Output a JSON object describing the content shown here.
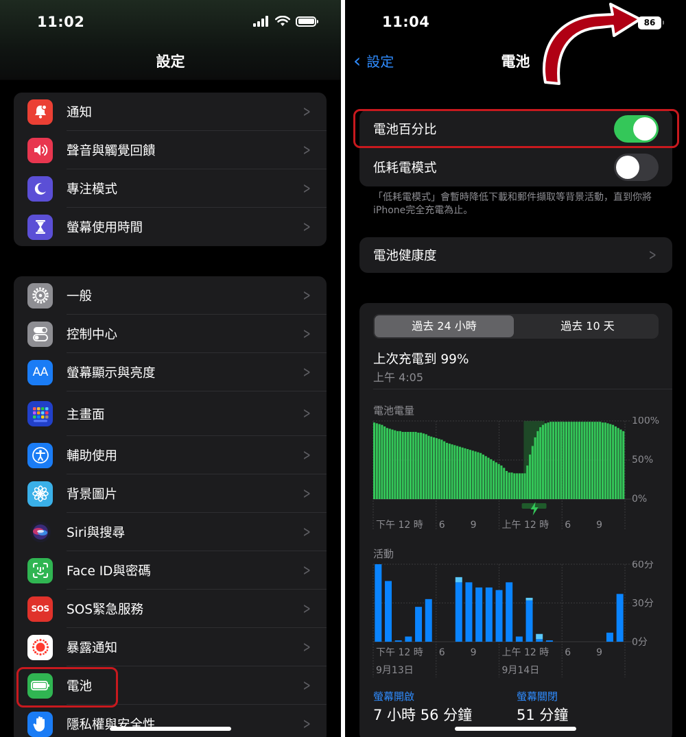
{
  "left": {
    "status_time": "11:02",
    "title": "設定",
    "group1": [
      {
        "label": "通知",
        "icon": "bell-icon",
        "color": "#eb4034"
      },
      {
        "label": "聲音與觸覺回饋",
        "icon": "speaker-icon",
        "color": "#e8364f"
      },
      {
        "label": "專注模式",
        "icon": "moon-icon",
        "color": "#5b4fd6"
      },
      {
        "label": "螢幕使用時間",
        "icon": "hourglass-icon",
        "color": "#5b4fd6"
      }
    ],
    "group2": [
      {
        "label": "一般",
        "icon": "gear-icon",
        "color": "#8e8e93"
      },
      {
        "label": "控制中心",
        "icon": "toggles-icon",
        "color": "#8e8e93"
      },
      {
        "label": "螢幕顯示與亮度",
        "icon": "text-size-icon",
        "color": "#1a7cf5"
      },
      {
        "label": "主畫面",
        "icon": "home-grid-icon",
        "color": "#2140c9"
      },
      {
        "label": "輔助使用",
        "icon": "accessibility-icon",
        "color": "#1a7cf5"
      },
      {
        "label": "背景圖片",
        "icon": "flower-icon",
        "color": "#3ab0e8"
      },
      {
        "label": "Siri與搜尋",
        "icon": "siri-icon",
        "color": "#1c1c1e"
      },
      {
        "label": "Face ID與密碼",
        "icon": "face-id-icon",
        "color": "#30b552"
      },
      {
        "label": "SOS緊急服務",
        "icon": "sos-icon",
        "color": "#e0322b"
      },
      {
        "label": "暴露通知",
        "icon": "exposure-icon",
        "color": "#ffffff"
      },
      {
        "label": "電池",
        "icon": "battery-icon",
        "color": "#30b552"
      },
      {
        "label": "隱私權與安全性",
        "icon": "hand-icon",
        "color": "#1a7cf5"
      }
    ],
    "icon_text": {
      "text_size": "AA",
      "sos": "SOS"
    }
  },
  "right": {
    "status_time": "11:04",
    "battery_percent": "86",
    "back_label": "設定",
    "title": "電池",
    "battery_percentage_label": "電池百分比",
    "battery_percentage_on": true,
    "low_power_label": "低耗電模式",
    "low_power_on": false,
    "footnote": "「低耗電模式」會暫時降低下載和郵件擷取等背景活動，直到你將iPhone完全充電為止。",
    "battery_health_label": "電池健康度",
    "segment": {
      "active": "過去 24 小時",
      "inactive": "過去 10 天"
    },
    "last_charge_title": "上次充電到 99%",
    "last_charge_time": "上午 4:05",
    "screen_on_label": "螢幕開啟",
    "screen_on_value": "7 小時 56 分鐘",
    "screen_off_label": "螢幕關閉",
    "screen_off_value": "51 分鐘"
  },
  "chart_data": [
    {
      "type": "bar",
      "title": "電池電量",
      "yticks": [
        "100%",
        "50%",
        "0%"
      ],
      "ylim": [
        0,
        100
      ],
      "xticks": [
        "下午 12 時",
        "6",
        "9",
        "上午 12 時",
        "6",
        "9"
      ],
      "charging_marker": "lightning-icon",
      "values": [
        98,
        97,
        96,
        95,
        93,
        91,
        90,
        89,
        88,
        87,
        87,
        86,
        86,
        86,
        86,
        86,
        86,
        85,
        85,
        84,
        83,
        81,
        80,
        79,
        78,
        77,
        76,
        74,
        72,
        71,
        70,
        69,
        68,
        67,
        66,
        65,
        64,
        63,
        62,
        61,
        60,
        59,
        57,
        55,
        53,
        51,
        49,
        47,
        45,
        43,
        40,
        36,
        34,
        34,
        33,
        33,
        33,
        33,
        33,
        43,
        57,
        68,
        79,
        87,
        92,
        95,
        97,
        98,
        99,
        99,
        99,
        99,
        99,
        99,
        99,
        99,
        99,
        99,
        99,
        99,
        99,
        99,
        99,
        99,
        99,
        99,
        99,
        99,
        98,
        98,
        97,
        96,
        95,
        93,
        91,
        89,
        87
      ],
      "color": "#34c759"
    },
    {
      "type": "bar",
      "title": "活動",
      "yticks": [
        "60分",
        "30分",
        "0分"
      ],
      "ylim": [
        0,
        60
      ],
      "xticks": [
        "下午 12 時",
        "6",
        "9",
        "上午 12 時",
        "6",
        "9"
      ],
      "date_labels": [
        "9月13日",
        "9月14日"
      ],
      "series": [
        {
          "name": "螢幕開啟",
          "color": "#0a84ff",
          "values": [
            60,
            47,
            1,
            4,
            27,
            33,
            0,
            0,
            46,
            46,
            42,
            42,
            40,
            46,
            4,
            32,
            2,
            1,
            0,
            0,
            0,
            0,
            0,
            7,
            37
          ]
        },
        {
          "name": "螢幕關閉",
          "color": "#5ac8fa",
          "values": [
            0,
            0,
            0,
            0,
            0,
            0,
            0,
            0,
            4,
            0,
            0,
            0,
            0,
            0,
            0,
            2,
            4,
            0,
            0,
            0,
            0,
            0,
            0,
            0,
            0
          ]
        }
      ]
    }
  ]
}
